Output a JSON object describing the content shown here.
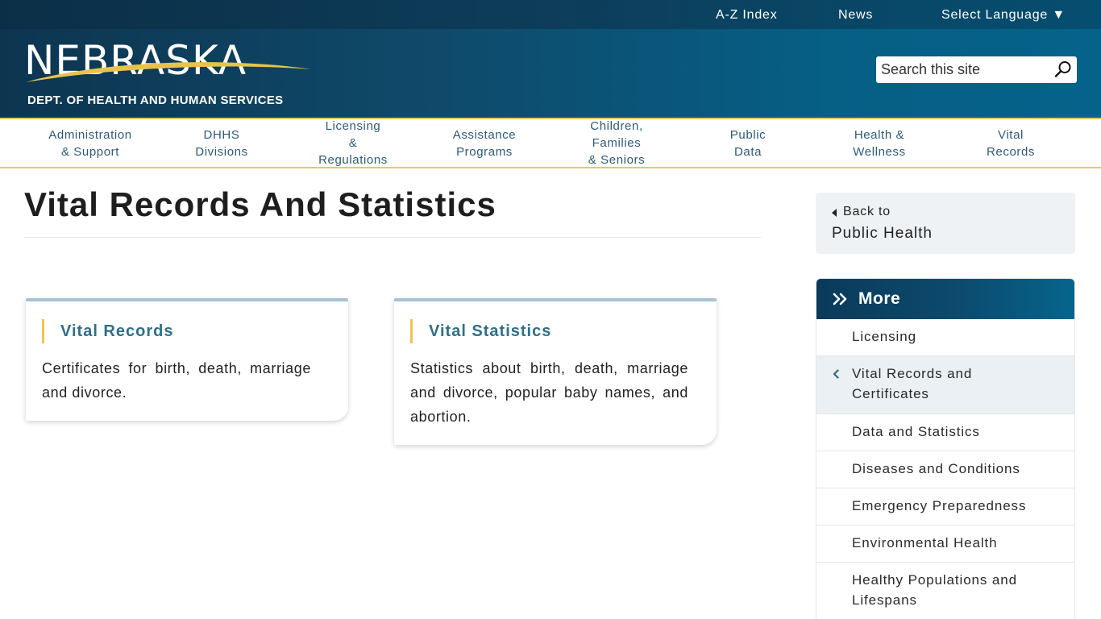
{
  "header": {
    "utility_links": [
      "A-Z Index",
      "News",
      "Select Language ▼"
    ],
    "logo_word": "NEBRASKA",
    "logo_sub": "DEPT. OF HEALTH AND HUMAN SERVICES",
    "search_placeholder": "Search this site",
    "colors": {
      "bar": "#0d3d5a",
      "accent_gold": "#e8c85a"
    }
  },
  "nav": {
    "items": [
      "Administration\n& Support",
      "DHHS\nDivisions",
      "Licensing\n&\nRegulations",
      "Assistance\nPrograms",
      "Children,\nFamilies\n& Seniors",
      "Public\nData",
      "Health &\nWellness",
      "Vital\nRecords"
    ]
  },
  "main": {
    "title": "Vital Records And Statistics",
    "cards": [
      {
        "title": "Vital Records",
        "description": "Certificates for birth, death, marriage and divorce."
      },
      {
        "title": "Vital Statistics",
        "description": "Statistics about birth, death, marriage and divorce, popular baby names, and abortion."
      }
    ]
  },
  "sidebar": {
    "back_label": "Back to",
    "back_target": "Public Health",
    "more_title": "More",
    "items": [
      "Licensing",
      "Vital Records and\nCertificates",
      "Data and Statistics",
      "Diseases and Conditions",
      "Emergency Preparedness",
      "Environmental Health",
      "Healthy Populations and\nLifespans"
    ],
    "active_index": 1
  }
}
